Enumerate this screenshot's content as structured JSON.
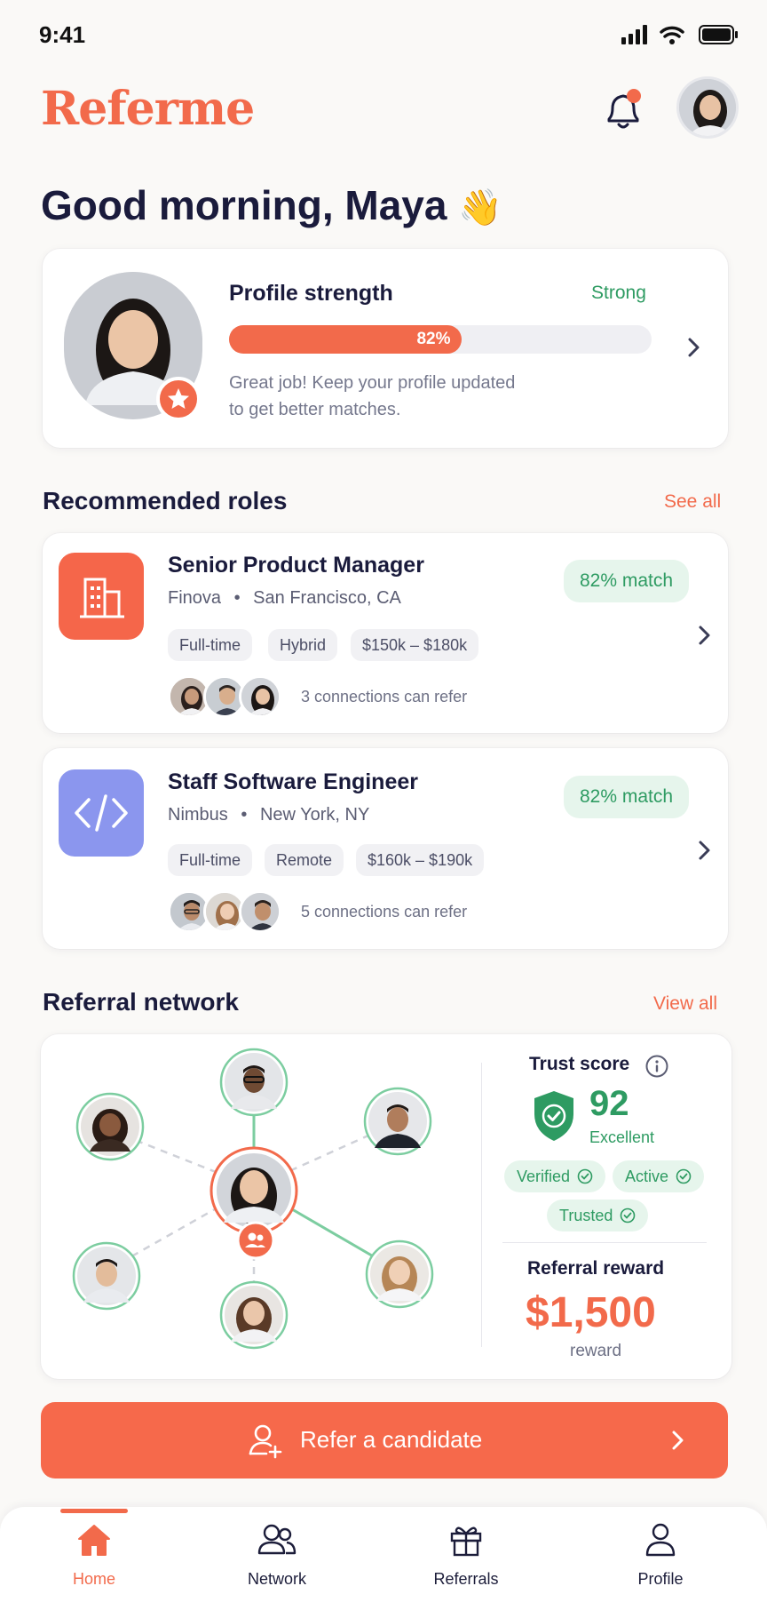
{
  "status_bar": {
    "time": "9:41"
  },
  "header": {
    "app_name": "Referme"
  },
  "greeting": {
    "text": "Good morning, Maya",
    "emoji": "👋"
  },
  "profile_strength": {
    "title": "Profile strength",
    "status": "Strong",
    "percent": 82,
    "percent_label": "82%",
    "message_line1": "Great job! Keep your profile updated",
    "message_line2": "to get better matches."
  },
  "recommended": {
    "title": "Recommended roles",
    "see_all": "See all",
    "roles": [
      {
        "title": "Senior Product Manager",
        "company": "Finova",
        "location": "San Francisco, CA",
        "match": "82% match",
        "tags": [
          "Full-time",
          "Hybrid",
          "$150k – $180k"
        ],
        "connections": "3 connections can refer",
        "icon": "building-icon"
      },
      {
        "title": "Staff Software Engineer",
        "company": "Nimbus",
        "location": "New York, NY",
        "match": "82% match",
        "tags": [
          "Full-time",
          "Remote",
          "$160k – $190k"
        ],
        "connections": "5 connections can refer",
        "icon": "code-icon"
      }
    ]
  },
  "network": {
    "title": "Referral network",
    "view_all": "View all",
    "trust_label": "Trust score",
    "trust_score": "92",
    "trust_level": "Excellent",
    "badges": [
      "Verified",
      "Active",
      "Trusted"
    ],
    "reward_label": "Referral reward",
    "reward_amount": "$1,500",
    "reward_sub": "reward"
  },
  "cta": {
    "label": "Refer a candidate"
  },
  "nav": {
    "items": [
      {
        "label": "Home",
        "icon": "home-icon"
      },
      {
        "label": "Network",
        "icon": "network-icon"
      },
      {
        "label": "Referrals",
        "icon": "gift-icon"
      },
      {
        "label": "Profile",
        "icon": "person-icon"
      }
    ]
  },
  "colors": {
    "accent": "#f26a4b",
    "green": "#2e9b62",
    "navy": "#1a1b3c",
    "purple": "#8b96ee"
  }
}
